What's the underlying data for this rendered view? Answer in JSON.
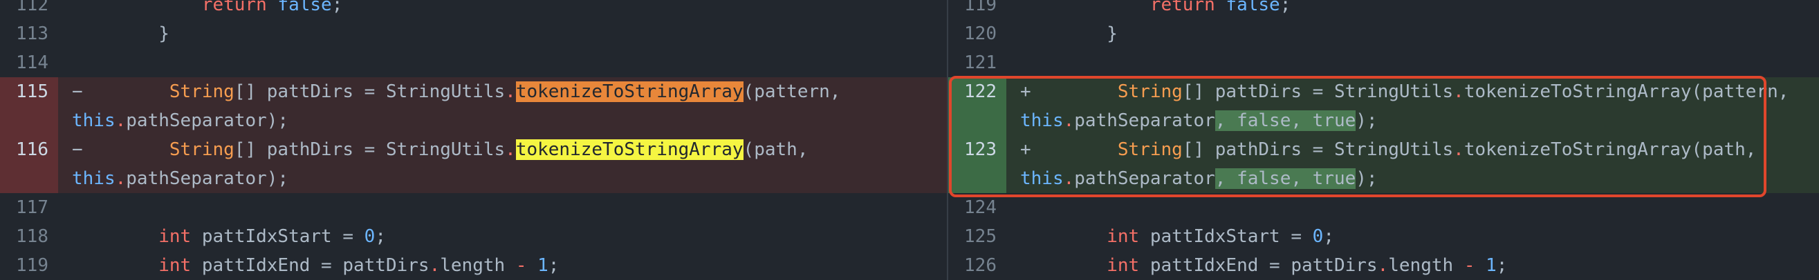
{
  "left": {
    "lines": [
      {
        "num": "112",
        "indent": "            ",
        "kw": "return",
        "val": "false",
        "end": ";"
      },
      {
        "num": "113",
        "text": "        }"
      },
      {
        "num": "114",
        "text": ""
      },
      {
        "num": "115",
        "sign": "−",
        "pre": "        ",
        "type": "String",
        "mid": "[] pattDirs = StringUtils",
        "dot": ".",
        "hl": "tokenizeToStringArray",
        "post": "(pattern,",
        "this_kw": "this",
        "wrap": "pathSeparator);"
      },
      {
        "num": "116",
        "sign": "−",
        "pre": "        ",
        "type": "String",
        "mid": "[] pathDirs = StringUtils",
        "dot": ".",
        "hl": "tokenizeToStringArray",
        "post": "(path,",
        "this_kw": "this",
        "wrap": "pathSeparator);"
      },
      {
        "num": "117",
        "text": ""
      },
      {
        "num": "118",
        "indent": "        ",
        "kw": "int",
        "name": " pattIdxStart = ",
        "val": "0",
        "end": ";"
      },
      {
        "num": "119",
        "indent": "        ",
        "kw": "int",
        "name": " pattIdxEnd = pattDirs",
        "dot": ".",
        "prop": "length ",
        "op": "-",
        "val": " 1",
        "end": ";"
      }
    ]
  },
  "right": {
    "lines": [
      {
        "num": "119",
        "indent": "            ",
        "kw": "return",
        "val": "false",
        "end": ";"
      },
      {
        "num": "120",
        "text": "        }"
      },
      {
        "num": "121",
        "text": ""
      },
      {
        "num": "122",
        "sign": "+",
        "pre": "        ",
        "type": "String",
        "mid": "[] pattDirs = StringUtils",
        "dot": ".",
        "rest": "tokenizeToStringArray(pattern,",
        "this_kw": "this",
        "wrap": "pathSeparator",
        "hl": ", false, true",
        "end": ");"
      },
      {
        "num": "123",
        "sign": "+",
        "pre": "        ",
        "type": "String",
        "mid": "[] pathDirs = StringUtils",
        "dot": ".",
        "rest": "tokenizeToStringArray(path,",
        "this_kw": "this",
        "wrap": "pathSeparator",
        "hl": ", false, true",
        "end": ");"
      },
      {
        "num": "124",
        "text": ""
      },
      {
        "num": "125",
        "indent": "        ",
        "kw": "int",
        "name": " pattIdxStart = ",
        "val": "0",
        "end": ";"
      },
      {
        "num": "126",
        "indent": "        ",
        "kw": "int",
        "name": " pattIdxEnd = pattDirs",
        "dot": ".",
        "prop": "length ",
        "op": "-",
        "val": " 1",
        "end": ";"
      }
    ]
  },
  "colors": {
    "highlight_box": "#e0462c",
    "deletion": "#5e2f33",
    "addition": "#3c6b45"
  }
}
